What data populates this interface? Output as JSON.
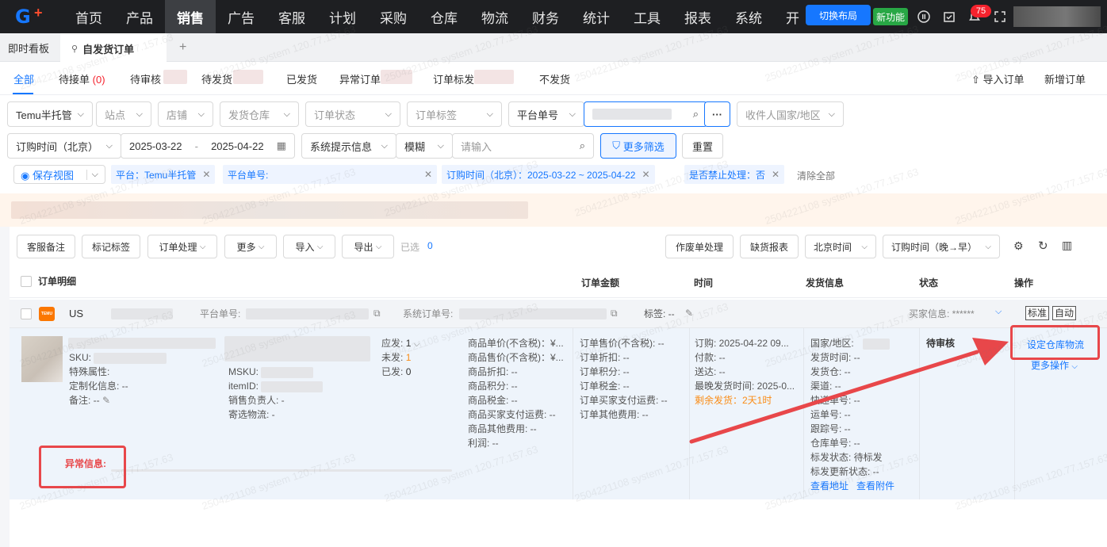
{
  "nav": {
    "items": [
      "首页",
      "产品",
      "销售",
      "广告",
      "客服",
      "计划",
      "采购",
      "仓库",
      "物流",
      "财务",
      "统计",
      "工具",
      "报表",
      "系统",
      "开"
    ],
    "active": "销售",
    "switch_layout": "切换布局",
    "new_feature": "新功能",
    "notification_count": "75"
  },
  "tabs": {
    "dashboard": "即时看板",
    "current": "自发货订单",
    "add": "+"
  },
  "status_tabs": {
    "all": "全部",
    "pending_receive": "待接单",
    "pending_receive_count": "(0)",
    "pending_review": "待审核",
    "pending_ship": "待发货",
    "shipped": "已发货",
    "abnormal": "异常订单",
    "tagged": "订单标发",
    "no_ship": "不发货",
    "import_orders": "导入订单",
    "new_order": "新增订单"
  },
  "filters": {
    "platform": "Temu半托管",
    "site": "站点",
    "store": "店铺",
    "warehouse": "发货仓库",
    "order_status": "订单状态",
    "order_tag": "订单标签",
    "platform_no": "平台单号",
    "country": "收件人国家/地区",
    "time_type": "订购时间（北京）",
    "date_start": "2025-03-22",
    "date_sep": "-",
    "date_end": "2025-04-22",
    "system_hint": "系统提示信息",
    "fuzzy": "模糊",
    "input_placeholder": "请输入",
    "more_filters": "更多筛选",
    "reset": "重置",
    "more_dots": "···"
  },
  "chips": {
    "save_view": "保存视图",
    "platform_chip": "平台：Temu半托管",
    "platform_no_chip": "平台单号:",
    "time_chip": "订购时间（北京）：2025-03-22 ~ 2025-04-22",
    "forbidden_chip": "是否禁止处理：否",
    "clear_all": "清除全部"
  },
  "toolbar": {
    "cs_note": "客服备注",
    "mark_tag": "标记标签",
    "order_process": "订单处理",
    "more": "更多",
    "import": "导入",
    "export": "导出",
    "selected_label": "已选",
    "selected_count": "0",
    "void_process": "作废单处理",
    "shortage_report": "缺货报表",
    "beijing_time": "北京时间",
    "sort_time": "订购时间（晚→早）"
  },
  "table_headers": {
    "detail": "订单明细",
    "amount": "订单金额",
    "time": "时间",
    "shipping": "发货信息",
    "status": "状态",
    "actions": "操作"
  },
  "order": {
    "country_code": "US",
    "store_icon_text": "TEMU",
    "platform_no_label": "平台单号:",
    "system_no_label": "系统订单号:",
    "tags_label": "标签: --",
    "buyer_info": "买家信息: ******",
    "badge_std": "标准",
    "badge_auto": "自动",
    "sku_label": "SKU:",
    "special_attr": "特殊属性:",
    "custom_info": "定制化信息: --",
    "remark": "备注: --",
    "msku_label": "MSKU:",
    "item_id_label": "itemID:",
    "sales_owner": "销售负责人: -",
    "consign_logistics": "寄选物流: -",
    "qty_due_label": "应发:",
    "qty_due": "1",
    "qty_unshipped_label": "未发:",
    "qty_unshipped": "1",
    "qty_shipped_label": "已发:",
    "qty_shipped": "0",
    "product_price_lines": [
      "商品单价(不含税)：¥...",
      "商品售价(不含税)：¥...",
      "商品折扣: --",
      "商品积分: --",
      "商品税金: --",
      "商品买家支付运费: --",
      "商品其他费用: --",
      "利润: --"
    ],
    "order_amount_lines": [
      "订单售价(不含税): --",
      "订单折扣: --",
      "订单积分: --",
      "订单税金: --",
      "订单买家支付运费: --",
      "订单其他费用: --"
    ],
    "time_lines": [
      "订购: 2025-04-22 09...",
      "付款: --",
      "送达: --",
      "最晚发货时间: 2025-0..."
    ],
    "remaining_ship": "剩余发货：2天1时",
    "ship_lines": [
      "国家/地区:",
      "发货时间: --",
      "发货仓: --",
      "渠道: --",
      "快递单号: --",
      "运单号: --",
      "跟踪号: --",
      "仓库单号: --",
      "标发状态: 待标发",
      "标发更新状态: --"
    ],
    "view_address": "查看地址",
    "view_attachment": "查看附件",
    "status": "待审核",
    "set_logistics": "设定仓库物流",
    "more_actions": "更多操作",
    "abnormal_info": "异常信息:"
  },
  "watermark": "2504221108 system 120.77.157.63",
  "colors": {
    "primary": "#1677ff",
    "annotation_red": "#e8474a",
    "nav_bg": "#1e1f22"
  }
}
